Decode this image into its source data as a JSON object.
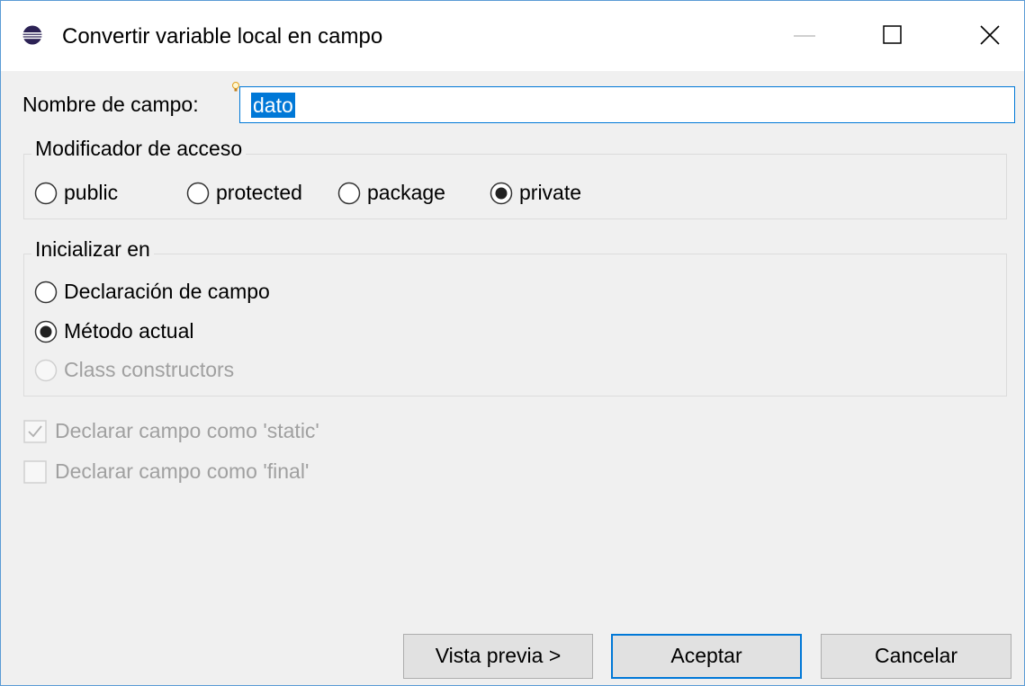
{
  "window": {
    "title": "Convertir variable local en campo",
    "app_icon": "eclipse-icon",
    "controls": {
      "minimize_icon": "minimize-icon",
      "maximize_icon": "maximize-icon",
      "close_icon": "close-icon"
    }
  },
  "field_name": {
    "label": "Nombre de campo:",
    "value": "dato",
    "hint_icon": "lightbulb-icon"
  },
  "access_modifier": {
    "title": "Modificador de acceso",
    "options": [
      {
        "label": "public",
        "selected": false
      },
      {
        "label": "protected",
        "selected": false
      },
      {
        "label": "package",
        "selected": false
      },
      {
        "label": "private",
        "selected": true
      }
    ]
  },
  "initialize_in": {
    "title": "Inicializar en",
    "options": [
      {
        "label": "Declaración de campo",
        "selected": false,
        "enabled": true
      },
      {
        "label": "Método actual",
        "selected": true,
        "enabled": true
      },
      {
        "label": "Class constructors",
        "selected": false,
        "enabled": false
      }
    ]
  },
  "checkboxes": [
    {
      "label": "Declarar campo como 'static'",
      "checked": true,
      "enabled": false
    },
    {
      "label": "Declarar campo como 'final'",
      "checked": false,
      "enabled": false
    }
  ],
  "buttons": {
    "preview": "Vista previa >",
    "ok": "Aceptar",
    "cancel": "Cancelar"
  },
  "colors": {
    "accent": "#0078d7",
    "disabled_text": "#a0a0a0",
    "dialog_bg": "#f0f0f0"
  }
}
